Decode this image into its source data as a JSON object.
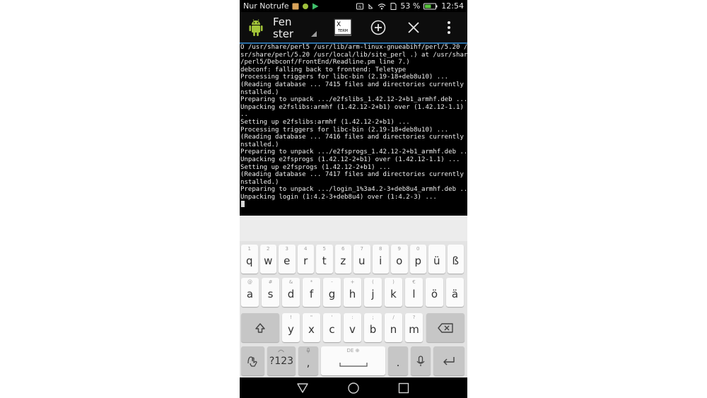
{
  "status_bar": {
    "carrier": "Nur Notrufe",
    "battery": "53 %",
    "time": "12:54"
  },
  "action_bar": {
    "title_line1": "Fen",
    "title_line2": "ster",
    "xterm_label_x": "X",
    "xterm_label_term": "TERM",
    "accent_color": "#2b6ea5"
  },
  "terminal": {
    "lines": [
      "O /usr/share/perl5 /usr/lib/arm-linux-gnueabihf/perl/5.20 /u",
      "sr/share/perl/5.20 /usr/local/lib/site_perl .) at /usr/share",
      "/perl5/Debconf/FrontEnd/Readline.pm line 7.)",
      "debconf: falling back to frontend: Teletype",
      "Processing triggers for libc-bin (2.19-18+deb8u10) ...",
      "(Reading database ... 7415 files and directories currently i",
      "nstalled.)",
      "Preparing to unpack .../e2fslibs_1.42.12-2+b1_armhf.deb ...",
      "Unpacking e2fslibs:armhf (1.42.12-2+b1) over (1.42.12-1.1) .",
      "..",
      "Setting up e2fslibs:armhf (1.42.12-2+b1) ...",
      "Processing triggers for libc-bin (2.19-18+deb8u10) ...",
      "(Reading database ... 7416 files and directories currently i",
      "nstalled.)",
      "Preparing to unpack .../e2fsprogs_1.42.12-2+b1_armhf.deb ...",
      "Unpacking e2fsprogs (1.42.12-2+b1) over (1.42.12-1.1) ...",
      "Setting up e2fsprogs (1.42.12-2+b1) ...",
      "(Reading database ... 7417 files and directories currently i",
      "nstalled.)",
      "Preparing to unpack .../login_1%3a4.2-3+deb8u4_armhf.deb ...",
      "Unpacking login (1:4.2-3+deb8u4) over (1:4.2-3) ..."
    ]
  },
  "keyboard": {
    "row1": [
      {
        "label": "q",
        "hint": "1"
      },
      {
        "label": "w",
        "hint": "2"
      },
      {
        "label": "e",
        "hint": "3"
      },
      {
        "label": "r",
        "hint": "4"
      },
      {
        "label": "t",
        "hint": "5"
      },
      {
        "label": "z",
        "hint": "6"
      },
      {
        "label": "u",
        "hint": "7"
      },
      {
        "label": "i",
        "hint": "8"
      },
      {
        "label": "o",
        "hint": "9"
      },
      {
        "label": "p",
        "hint": "0"
      },
      {
        "label": "ü",
        "hint": ""
      },
      {
        "label": "ß",
        "hint": ""
      }
    ],
    "row2": [
      {
        "label": "a",
        "hint": "@"
      },
      {
        "label": "s",
        "hint": "#"
      },
      {
        "label": "d",
        "hint": "&"
      },
      {
        "label": "f",
        "hint": "*"
      },
      {
        "label": "g",
        "hint": "-"
      },
      {
        "label": "h",
        "hint": "+"
      },
      {
        "label": "j",
        "hint": "("
      },
      {
        "label": "k",
        "hint": ")"
      },
      {
        "label": "l",
        "hint": "€"
      },
      {
        "label": "ö",
        "hint": ""
      },
      {
        "label": "ä",
        "hint": ""
      }
    ],
    "row3": [
      {
        "label": "y",
        "hint": "!"
      },
      {
        "label": "x",
        "hint": "\""
      },
      {
        "label": "c",
        "hint": "'"
      },
      {
        "label": "v",
        "hint": ":"
      },
      {
        "label": "b",
        "hint": ";"
      },
      {
        "label": "n",
        "hint": "/"
      },
      {
        "label": "m",
        "hint": "?"
      }
    ],
    "symbols_key": "?123",
    "symbols_hint": "",
    "comma_key": ",",
    "comma_hint": "",
    "space_hint": "DE ⊕",
    "period_key": ".",
    "period_hint": ""
  }
}
